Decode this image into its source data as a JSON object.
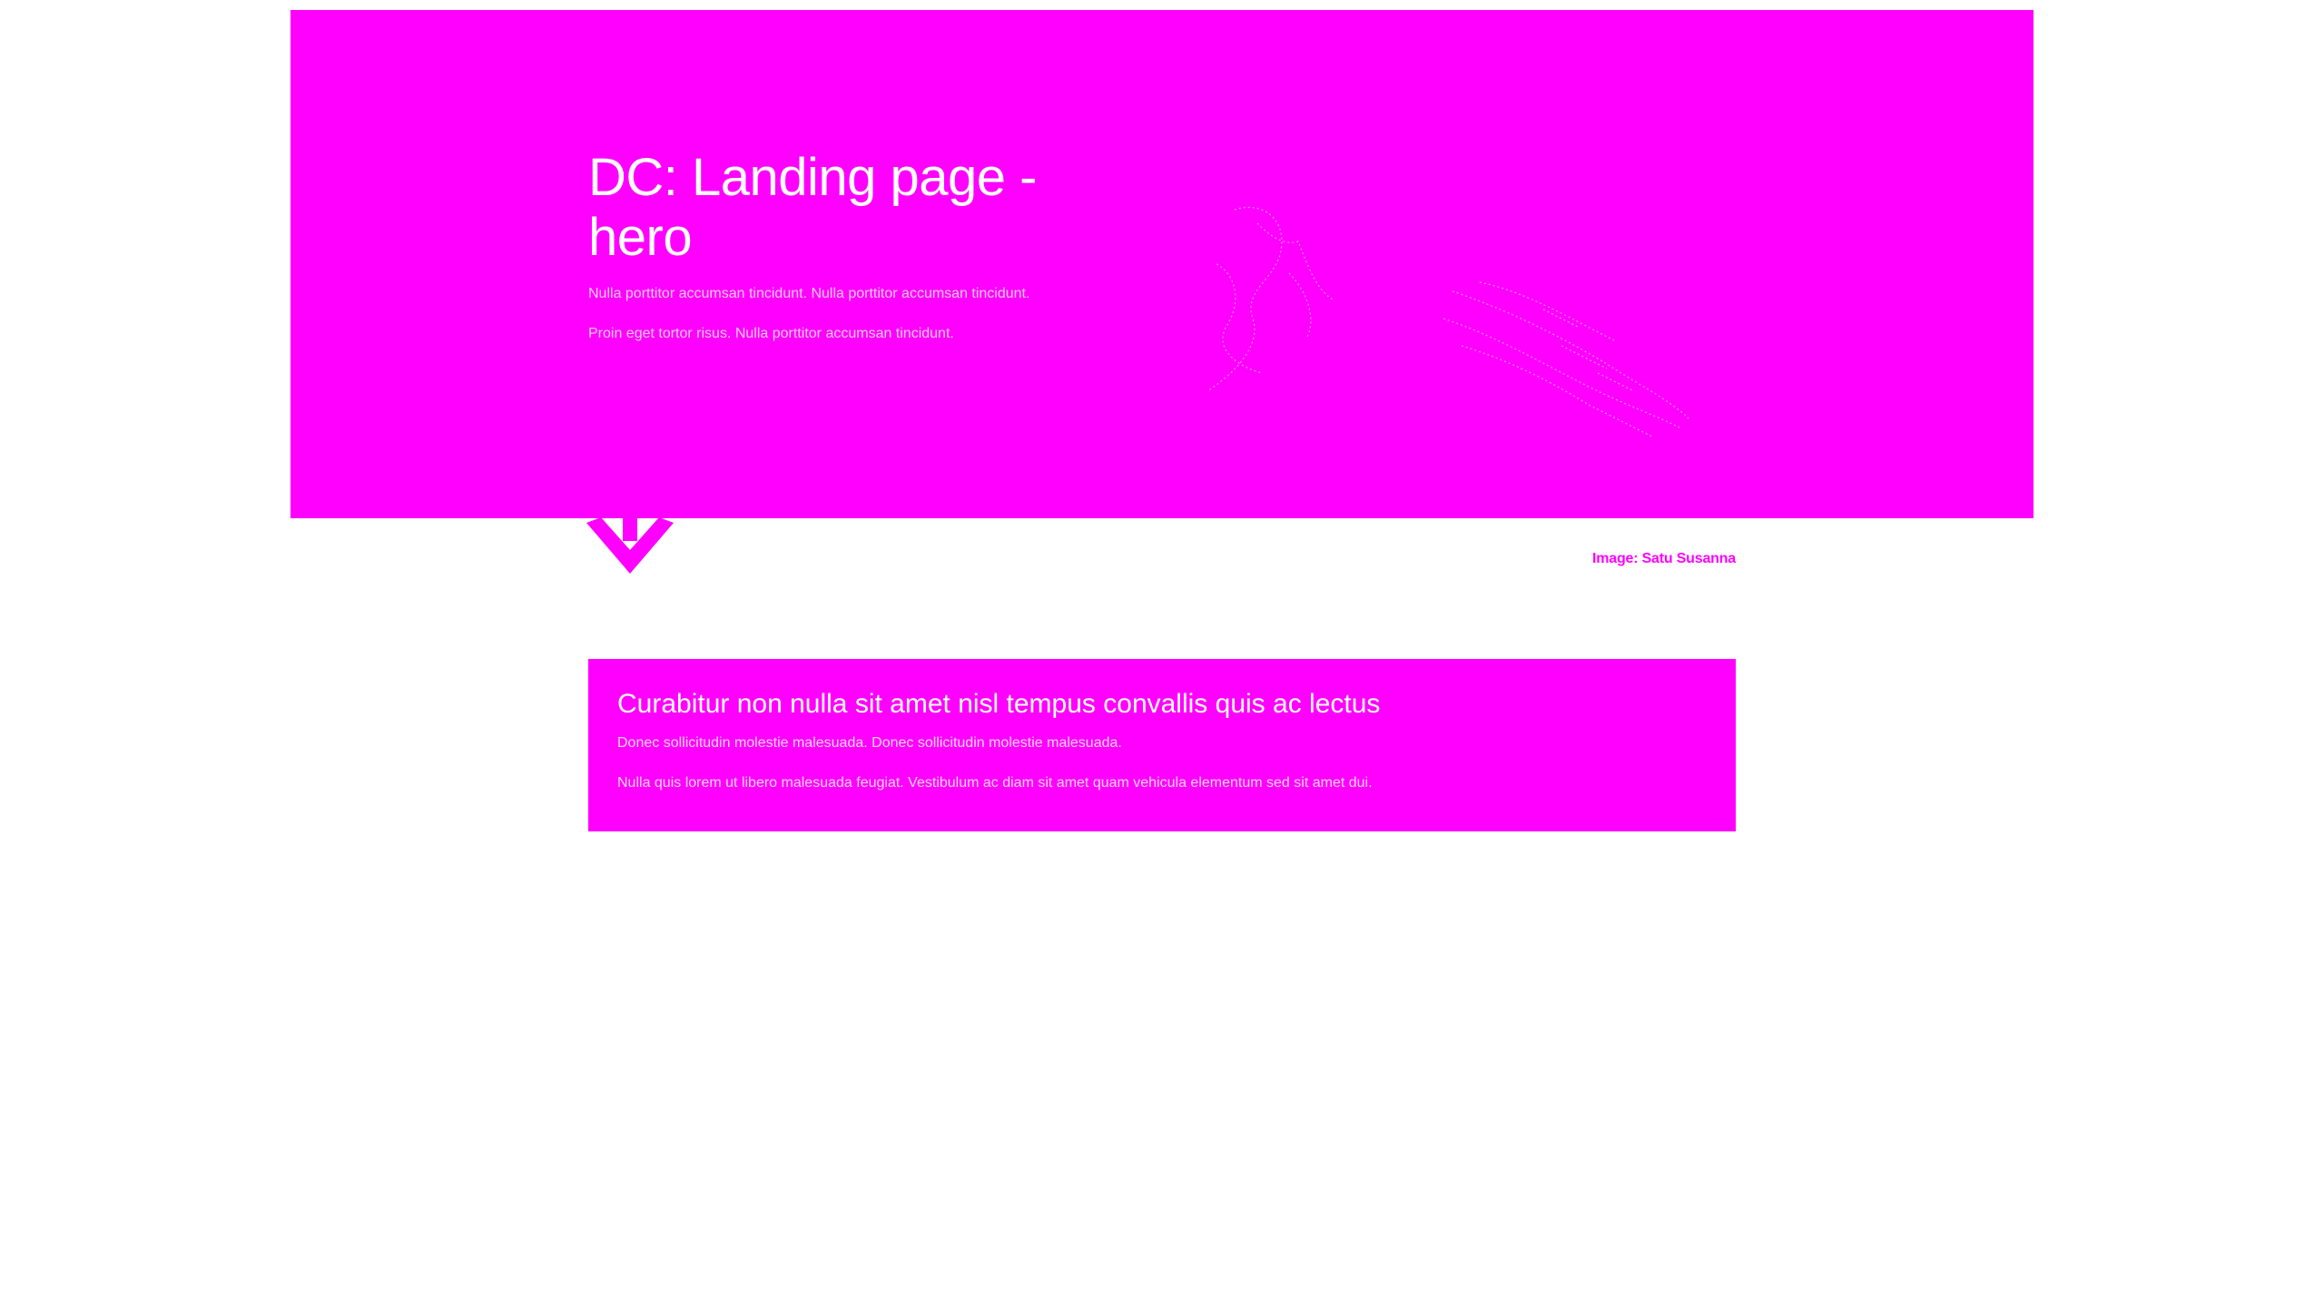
{
  "colors": {
    "accent": "#ff00ff",
    "background": "#ffffff",
    "text_on_accent": "#ffffff"
  },
  "hero": {
    "title": "DC: Landing page - hero",
    "paragraphs": [
      "Nulla porttitor accumsan tincidunt. Nulla porttitor accumsan tincidunt.",
      "Proin eget tortor risus. Nulla porttitor accumsan tincidunt."
    ],
    "image_icon": "line-art-illustration",
    "scroll_icon": "chevron-down-icon"
  },
  "caption": {
    "text": "Image: Satu Susanna"
  },
  "info_box": {
    "title": "Curabitur non nulla sit amet nisl tempus convallis quis ac lectus",
    "paragraphs": [
      "Donec sollicitudin molestie malesuada. Donec sollicitudin molestie malesuada.",
      "Nulla quis lorem ut libero malesuada feugiat. Vestibulum ac diam sit amet quam vehicula elementum sed sit amet dui."
    ]
  }
}
